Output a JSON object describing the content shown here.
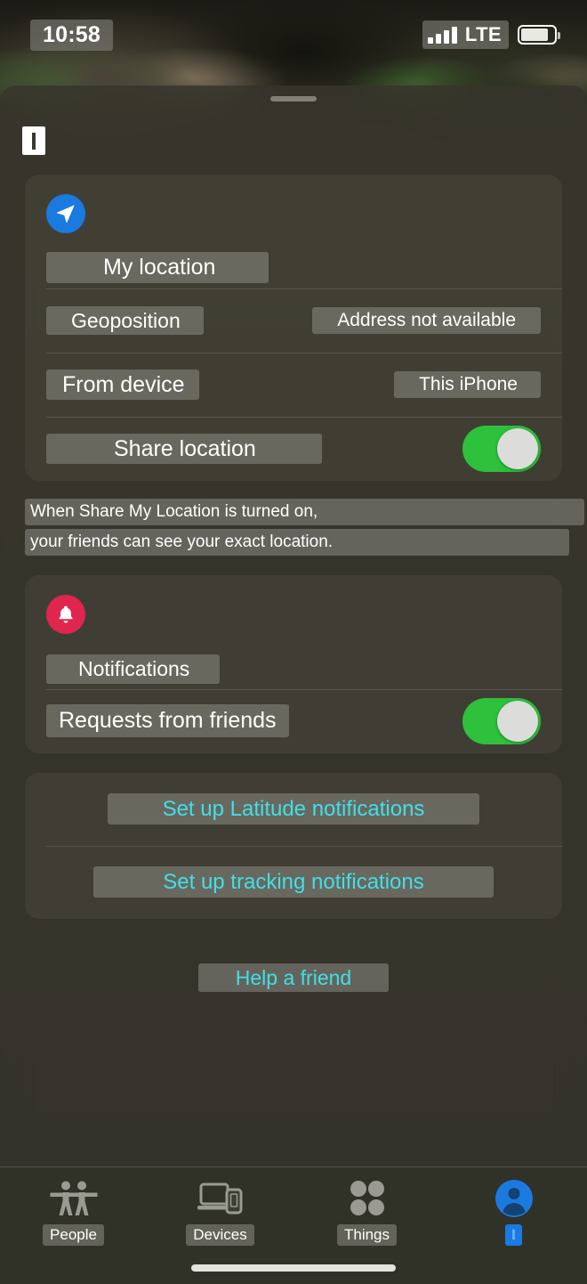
{
  "status_bar": {
    "time": "10:58",
    "network": "LTE",
    "signal_bars": 4,
    "battery_level_pct": 84,
    "signal_icon": "signal-bars-icon",
    "battery_icon": "battery-icon"
  },
  "sheet": {
    "grabber": "sheet-grabber",
    "title_truncated": "I"
  },
  "location_card": {
    "icon": "navigation-arrow-icon",
    "icon_color": "#1b7ae0",
    "title": "My location",
    "rows": [
      {
        "label": "Geoposition",
        "value": "Address not available"
      },
      {
        "label": "From device",
        "value": "This iPhone"
      }
    ],
    "share": {
      "label": "Share location",
      "toggle_on": true,
      "toggle_color": "#2dc13c"
    },
    "note_line_1": "When Share My Location is turned on,",
    "note_line_2": "your friends can see your exact location."
  },
  "notifications_card": {
    "icon": "bell-icon",
    "icon_color": "#e0254e",
    "title": "Notifications",
    "requests": {
      "label": "Requests from friends",
      "toggle_on": true,
      "toggle_color": "#2dc13c"
    }
  },
  "links_card": {
    "link_color": "#3fe0e8",
    "items": [
      {
        "label": "Set up Latitude notifications"
      },
      {
        "label": "Set up tracking notifications"
      }
    ]
  },
  "help": {
    "label": "Help a friend"
  },
  "tab_bar": {
    "tabs": [
      {
        "label": "People",
        "icon": "two-people-icon",
        "selected": false
      },
      {
        "label": "Devices",
        "icon": "laptop-phone-icon",
        "selected": false
      },
      {
        "label": "Things",
        "icon": "four-dots-icon",
        "selected": false
      },
      {
        "label": "I",
        "icon": "person-circle-icon",
        "selected": true
      }
    ],
    "selected_color": "#1b7ae0"
  }
}
